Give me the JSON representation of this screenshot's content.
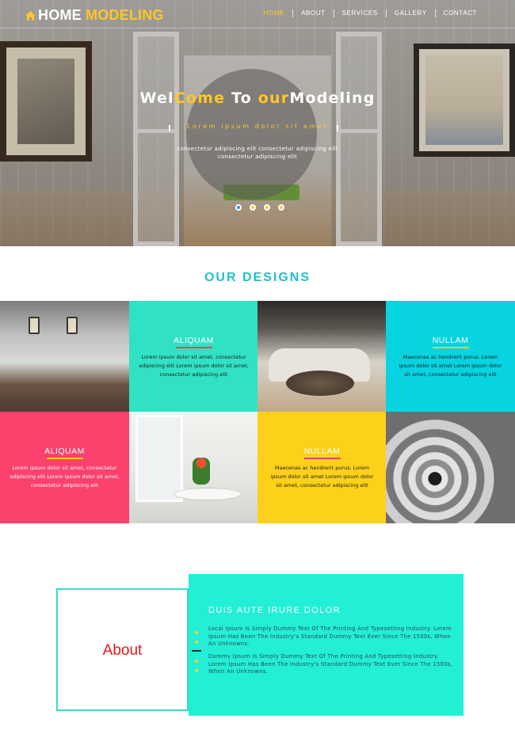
{
  "brand": {
    "part1": "HOME",
    "part2": "MODELING",
    "accent": "#ffc629"
  },
  "nav": [
    {
      "label": "HOME",
      "active": true
    },
    {
      "label": "ABOUT",
      "active": false
    },
    {
      "label": "SERVICES",
      "active": false
    },
    {
      "label": "GALLERY",
      "active": false
    },
    {
      "label": "CONTACT",
      "active": false
    }
  ],
  "hero": {
    "title_parts": [
      "Wel",
      "Come",
      " To ",
      "our",
      "Modeling"
    ],
    "subtitle": "Lorem ipsum dolor sit amet",
    "text": "consectetur adipiscing elit consectetur adipiscing elit consectetur adipiscing elit",
    "slides": 4,
    "active_slide": 1
  },
  "designs": {
    "title": "OUR DESIGNS",
    "cells": [
      {
        "title": "ALIQUAM",
        "text": "Lorem ipsum dolor sit amet, consectetur adipiscing elit Lorem ipsum dolor sit amet, consectetur adipiscing elit"
      },
      {
        "title": "NULLAM",
        "text": "Maecenas ac hendrerit purus. Lorem ipsum dolor sit amet Lorem ipsum dolor sit amet, consectetur adipiscing elit"
      },
      {
        "title": "ALIQUAM",
        "text": "Lorem ipsum dolor sit amet, consectetur adipiscing elit Lorem ipsum dolor sit amet, consectetur adipiscing elit"
      },
      {
        "title": "NULLAM",
        "text": "Maecenas ac hendrerit purus. Lorem ipsum dolor sit amet Lorem ipsum dolor sit amet, consectetur adipiscing elit"
      }
    ]
  },
  "about": {
    "title": "About",
    "heading": "DUIS AUTE IRURE DOLOR",
    "para1": "Local Ipsum Is Simply Dummy Text Of The Printing And Typesetting Industry. Lorem Ipsum Has Been The Industry's Standard Dummy Text Ever Since The 1500s, When An Unknowns.",
    "para2": "Dummy Ipsum Is Simply Dummy Text Of The Printing And Typesetting Industry. Lorem Ipsum Has Been The Industry's Standard Dummy Text Ever Since The 1500s, When An Unknowns."
  },
  "colors": {
    "aqua": "#31e1c4",
    "cyan": "#08d3e1",
    "pink": "#fb416c",
    "yellow": "#fdd01a",
    "teal_title": "#1ec2c9",
    "about_red": "#e3171c"
  },
  "icons": {
    "logo": "home-icon"
  }
}
